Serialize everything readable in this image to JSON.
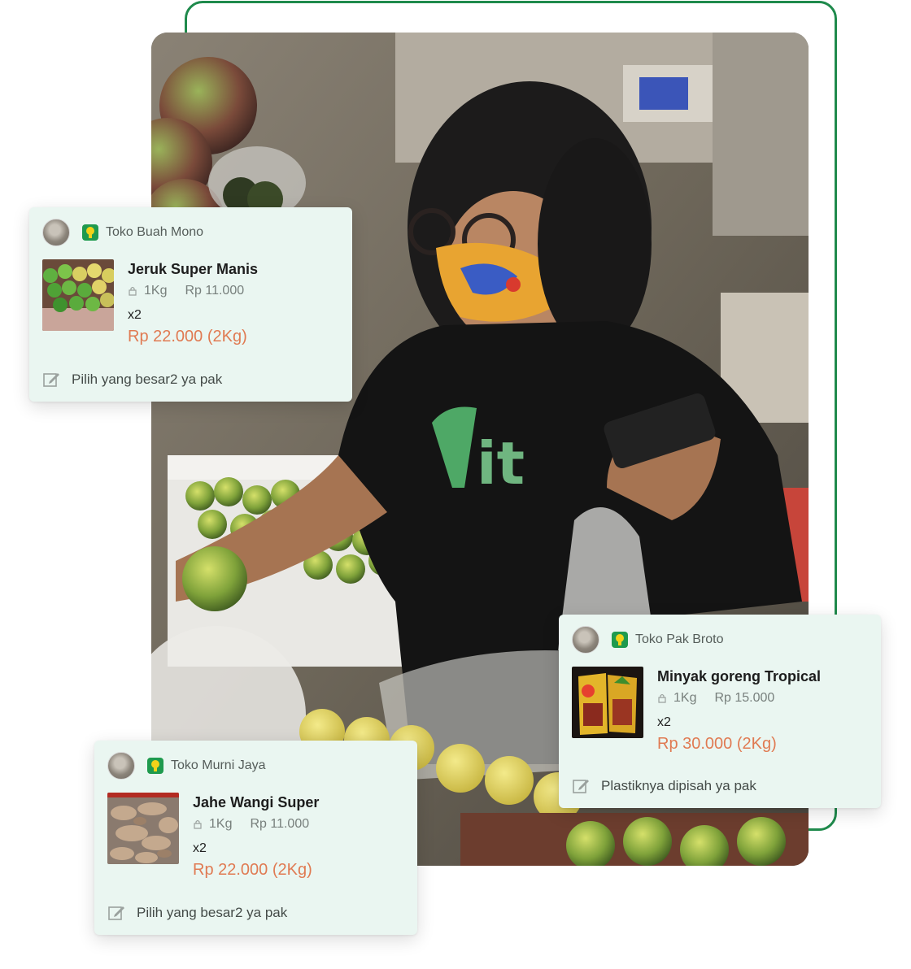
{
  "cards": [
    {
      "store": "Toko Buah Mono",
      "product": "Jeruk Super Manis",
      "unit": "1Kg",
      "unit_price": "Rp 11.000",
      "qty": "x2",
      "total": "Rp 22.000 (2Kg)",
      "note": "Pilih yang besar2 ya pak"
    },
    {
      "store": "Toko Pak Broto",
      "product": "Minyak goreng Tropical",
      "unit": "1Kg",
      "unit_price": "Rp 15.000",
      "qty": "x2",
      "total": "Rp 30.000 (2Kg)",
      "note": "Plastiknya dipisah ya pak"
    },
    {
      "store": "Toko Murni Jaya",
      "product": "Jahe Wangi Super",
      "unit": "1Kg",
      "unit_price": "Rp 11.000",
      "qty": "x2",
      "total": "Rp 22.000 (2Kg)",
      "note": "Pilih yang besar2 ya pak"
    }
  ],
  "photo": {
    "shirt_text": "it"
  },
  "colors": {
    "accent_green": "#1f8a4c",
    "price_orange": "#e07a52",
    "card_bg": "#eaf6f1"
  }
}
